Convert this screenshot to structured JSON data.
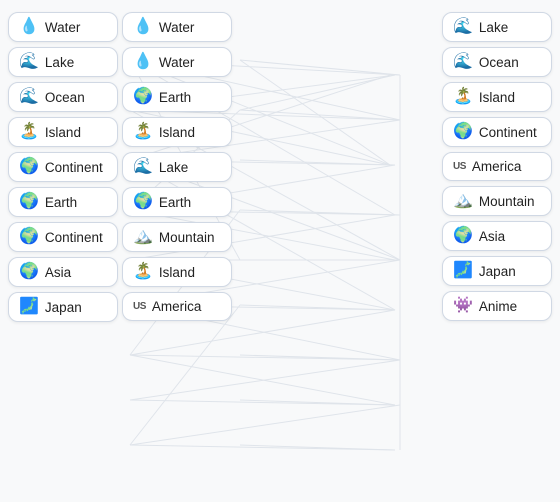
{
  "left_col1": [
    {
      "label": "Water",
      "icon": "💧",
      "type": "emoji"
    },
    {
      "label": "Lake",
      "icon": "🌊",
      "type": "emoji"
    },
    {
      "label": "Ocean",
      "icon": "🌊",
      "type": "emoji"
    },
    {
      "label": "Island",
      "icon": "🏝️",
      "type": "emoji"
    },
    {
      "label": "Continent",
      "icon": "🌍",
      "type": "emoji"
    },
    {
      "label": "Earth",
      "icon": "🌍",
      "type": "emoji"
    },
    {
      "label": "Continent",
      "icon": "🌍",
      "type": "emoji"
    },
    {
      "label": "Asia",
      "icon": "🌍",
      "type": "emoji"
    },
    {
      "label": "Japan",
      "icon": "🗾",
      "type": "emoji"
    }
  ],
  "left_col2": [
    {
      "label": "Water",
      "icon": "💧",
      "type": "emoji"
    },
    {
      "label": "Water",
      "icon": "💧",
      "type": "emoji"
    },
    {
      "label": "Earth",
      "icon": "🌍",
      "type": "emoji"
    },
    {
      "label": "Island",
      "icon": "🏝️",
      "type": "emoji"
    },
    {
      "label": "Lake",
      "icon": "🌊",
      "type": "emoji"
    },
    {
      "label": "Earth",
      "icon": "🌍",
      "type": "emoji"
    },
    {
      "label": "Mountain",
      "icon": "🏔️",
      "type": "emoji"
    },
    {
      "label": "Island",
      "icon": "🏝️",
      "type": "emoji"
    },
    {
      "label": "America",
      "icon": "US",
      "type": "us"
    }
  ],
  "right_col": [
    {
      "label": "Lake",
      "icon": "🌊",
      "type": "emoji"
    },
    {
      "label": "Ocean",
      "icon": "🌊",
      "type": "emoji"
    },
    {
      "label": "Island",
      "icon": "🏝️",
      "type": "emoji"
    },
    {
      "label": "Continent",
      "icon": "🌍",
      "type": "emoji"
    },
    {
      "label": "America",
      "icon": "US",
      "type": "us"
    },
    {
      "label": "Mountain",
      "icon": "🏔️",
      "type": "emoji"
    },
    {
      "label": "Asia",
      "icon": "🌍",
      "type": "emoji"
    },
    {
      "label": "Japan",
      "icon": "🗾",
      "type": "emoji"
    },
    {
      "label": "Anime",
      "icon": "👾",
      "type": "emoji"
    }
  ]
}
